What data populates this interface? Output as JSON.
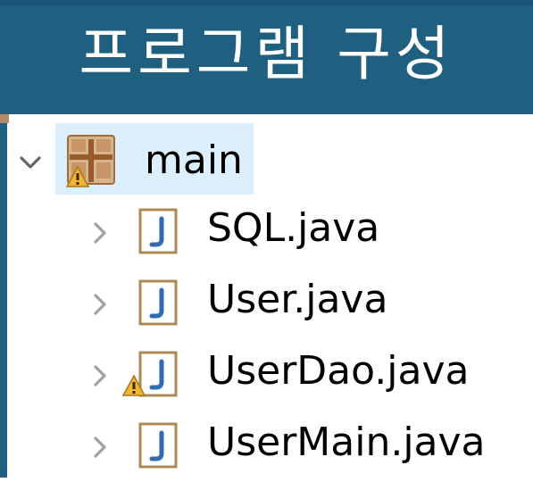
{
  "title": "프로그램 구성",
  "tree": {
    "package": {
      "label": "main",
      "icon": "java-package-icon",
      "expanded": true,
      "selected": true,
      "has_warning": true
    },
    "files": [
      {
        "label": "SQL.java",
        "icon": "java-file-icon",
        "has_warning": false
      },
      {
        "label": "User.java",
        "icon": "java-file-icon",
        "has_warning": false
      },
      {
        "label": "UserDao.java",
        "icon": "java-file-icon",
        "has_warning": true
      },
      {
        "label": "UserMain.java",
        "icon": "java-file-icon",
        "has_warning": false
      }
    ]
  },
  "colors": {
    "header_background": "#1f5f7f",
    "header_text": "#ffffff",
    "selection": "#dbefff",
    "warning": "#f2b632",
    "java_icon_blue": "#2c6db5",
    "java_icon_frame": "#a98a53",
    "package_icon": "#b67b50"
  }
}
